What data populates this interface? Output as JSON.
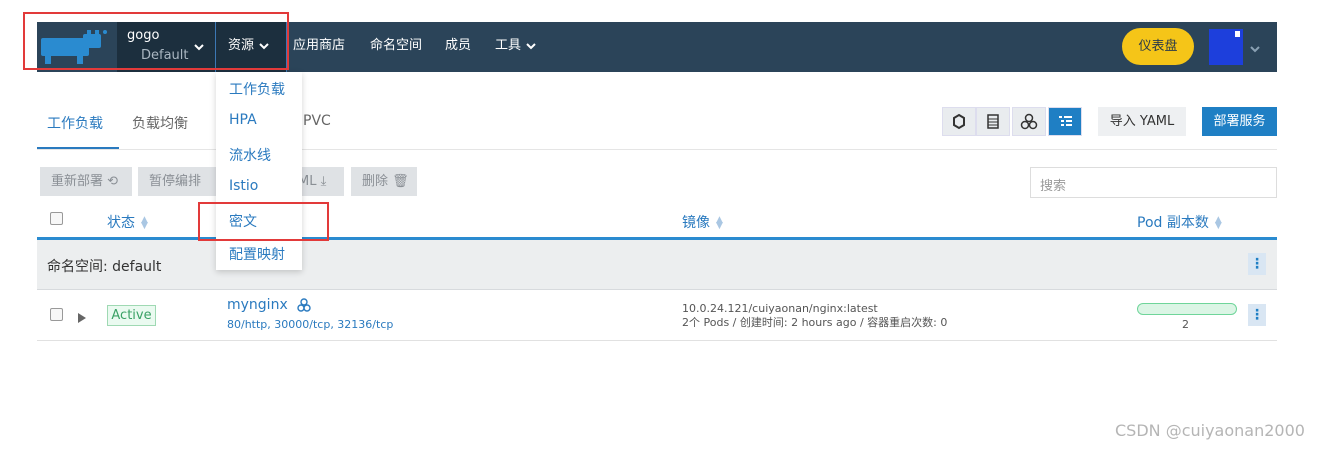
{
  "header": {
    "project_name": "gogo",
    "project_cluster": "Default",
    "nav": [
      "资源",
      "应用商店",
      "命名空间",
      "成员",
      "工具"
    ],
    "dashboard_label": "仪表盘",
    "avatar_color": "#1d3fdc",
    "brand_color": "#2b4459"
  },
  "dropdown": {
    "items": [
      "工作负载",
      "HPA",
      "流水线",
      "Istio",
      "密文",
      "配置映射"
    ]
  },
  "tabs": [
    "工作负载",
    "负载均衡",
    "PVC"
  ],
  "toolbar": {
    "view_icons": [
      "hexagon-icon",
      "list-icon",
      "group-icon",
      "tree-icon"
    ],
    "import_label": "导入 YAML",
    "deploy_label": "部署服务"
  },
  "actions": {
    "redeploy": "重新部署",
    "pause": "暂停编排",
    "yaml_fragment": "ML",
    "delete": "删除",
    "search_placeholder": "搜索"
  },
  "table": {
    "headers": {
      "status": "状态",
      "image": "镜像",
      "pods": "Pod 副本数"
    },
    "group_label": "命名空间: default",
    "rows": [
      {
        "status": "Active",
        "name": "mynginx",
        "ports": "80/http, 30000/tcp, 32136/tcp",
        "image": "10.0.24.121/cuiyaonan/nginx:latest",
        "meta": "2个 Pods / 创建时间: 2 hours ago / 容器重启次数: 0",
        "pod_count": "2",
        "pod_progress": 1.0
      }
    ]
  },
  "watermark": "CSDN @cuiyaonan2000"
}
